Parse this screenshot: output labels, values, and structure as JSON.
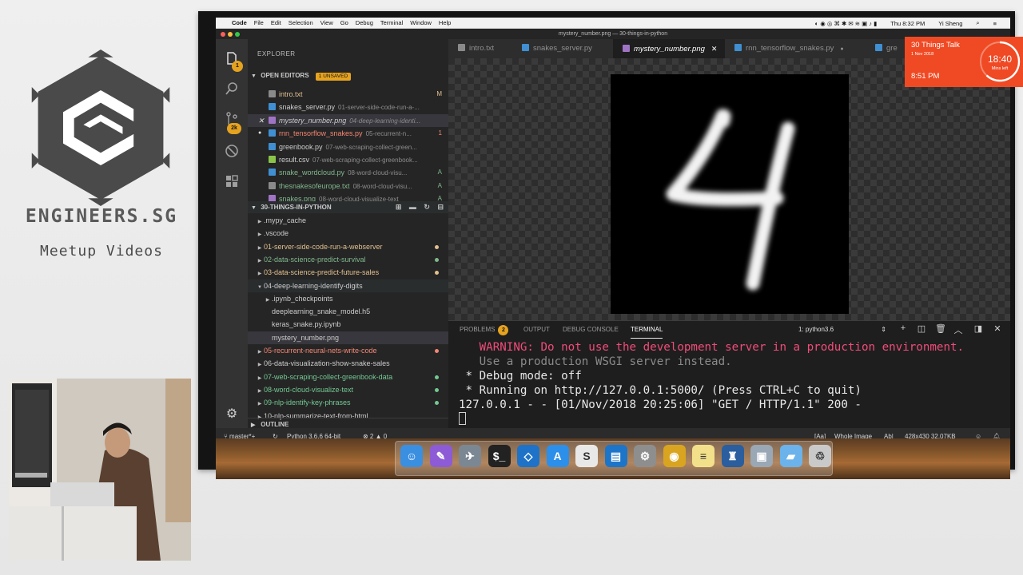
{
  "branding": {
    "name": "ENGINEERS.SG",
    "subtitle": "Meetup Videos"
  },
  "menubar": {
    "apple": "",
    "app": "Code",
    "items": [
      "File",
      "Edit",
      "Selection",
      "View",
      "Go",
      "Debug",
      "Terminal",
      "Window",
      "Help"
    ],
    "clock": "Thu 8:32 PM",
    "user": "Yi Sheng"
  },
  "window": {
    "title": "mystery_number.png — 30-things-in-python"
  },
  "activity": {
    "explorer_badge": "1",
    "scm_badge": "2k"
  },
  "sidebar": {
    "title": "EXPLORER",
    "open_editors": {
      "label": "OPEN EDITORS",
      "badge": "1 UNSAVED",
      "items": [
        {
          "name": "intro.txt",
          "path": "",
          "status": "M",
          "color": "#e2c08d",
          "icon": "text-file-icon"
        },
        {
          "name": "snakes_server.py",
          "path": "01-server-side-code-run-a-...",
          "status": "",
          "color": "#cccccc",
          "icon": "python-file-icon"
        },
        {
          "name": "mystery_number.png",
          "path": "04-deep-learning-identi...",
          "status": "",
          "color": "#cccccc",
          "icon": "image-file-icon"
        },
        {
          "name": "rnn_tensorflow_snakes.py",
          "path": "05-recurrent-n...",
          "status": "1",
          "color": "#f48771",
          "icon": "python-file-icon"
        },
        {
          "name": "greenbook.py",
          "path": "07-web-scraping-collect-green...",
          "status": "",
          "color": "#cccccc",
          "icon": "python-file-icon"
        },
        {
          "name": "result.csv",
          "path": "07-web-scraping-collect-greenbook...",
          "status": "",
          "color": "#cccccc",
          "icon": "csv-file-icon"
        },
        {
          "name": "snake_wordcloud.py",
          "path": "08-word-cloud-visu...",
          "status": "A",
          "color": "#81b88b",
          "icon": "python-file-icon"
        },
        {
          "name": "thesnakesofeurope.txt",
          "path": "08-word-cloud-visu...",
          "status": "A",
          "color": "#81b88b",
          "icon": "text-file-icon"
        },
        {
          "name": "snakes.png",
          "path": "08-word-cloud-visualize-text",
          "status": "A",
          "color": "#81b88b",
          "icon": "image-file-icon"
        }
      ]
    },
    "project": {
      "label": "30-THINGS-IN-PYTHON",
      "items": [
        {
          "name": ".mypy_cache",
          "color": "#cccccc"
        },
        {
          "name": ".vscode",
          "color": "#cccccc"
        },
        {
          "name": "01-server-side-code-run-a-webserver",
          "color": "#e2c08d"
        },
        {
          "name": "02-data-science-predict-survival",
          "color": "#81b88b"
        },
        {
          "name": "03-data-science-predict-future-sales",
          "color": "#e2c08d"
        },
        {
          "name": "04-deep-learning-identify-digits",
          "color": "#cccccc"
        },
        {
          "name": ".ipynb_checkpoints",
          "color": "#cccccc"
        },
        {
          "name": "deeplearning_snake_model.h5",
          "color": "#cccccc"
        },
        {
          "name": "keras_snake.py.ipynb",
          "color": "#cccccc"
        },
        {
          "name": "mystery_number.png",
          "color": "#cccccc"
        },
        {
          "name": "05-recurrent-neural-nets-write-code",
          "color": "#f48771"
        },
        {
          "name": "06-data-visualization-show-snake-sales",
          "color": "#cccccc"
        },
        {
          "name": "07-web-scraping-collect-greenbook-data",
          "color": "#73c991"
        },
        {
          "name": "08-word-cloud-visualize-text",
          "color": "#73c991"
        },
        {
          "name": "09-nlp-identify-key-phrases",
          "color": "#73c991"
        },
        {
          "name": "10-nlp-summarize-text-from-html",
          "color": "#cccccc"
        }
      ]
    },
    "outline_label": "OUTLINE"
  },
  "tabs": [
    {
      "label": "intro.txt",
      "icon": "text-file-icon"
    },
    {
      "label": "snakes_server.py",
      "icon": "python-file-icon"
    },
    {
      "label": "mystery_number.png",
      "icon": "image-file-icon",
      "active": true
    },
    {
      "label": "rnn_tensorflow_snakes.py",
      "icon": "python-file-icon"
    },
    {
      "label": "gre",
      "icon": "python-file-icon"
    }
  ],
  "image_preview": {
    "glyph": "4"
  },
  "panel": {
    "tabs": [
      "PROBLEMS",
      "OUTPUT",
      "DEBUG CONSOLE",
      "TERMINAL"
    ],
    "problems_count": "2",
    "active_tab": "TERMINAL",
    "terminal_select": "1: python3.6",
    "terminal_lines": [
      {
        "text": "   WARNING: Do not use the development server in a production environment.",
        "style": "warn"
      },
      {
        "text": "   Use a production WSGI server instead.",
        "style": "dim"
      },
      {
        "text": " * Debug mode: off",
        "style": ""
      },
      {
        "text": " * Running on http://127.0.0.1:5000/ (Press CTRL+C to quit)",
        "style": ""
      },
      {
        "text": "127.0.0.1 - - [01/Nov/2018 20:25:06] \"GET / HTTP/1.1\" 200 -",
        "style": ""
      }
    ]
  },
  "statusbar": {
    "branch": "master*+",
    "python": "Python 3.6.6 64-bit",
    "problems": "⊗ 2 ▲ 0",
    "search_case": "[Aa]",
    "whole_image": "Whole Image",
    "ab": "Ab|",
    "image_info": "428x430 32.07KB"
  },
  "talk_timer": {
    "title": "30 Things Talk",
    "date": "1 Nov 2018",
    "time": "8:51 PM",
    "countdown": "18:40",
    "caption": "Mins left",
    "remaining_fraction": 0.62
  },
  "dock": [
    {
      "name": "finder-icon",
      "glyph": "☺",
      "color": "#3a8fe0"
    },
    {
      "name": "quill-icon",
      "glyph": "✎",
      "color": "#8e5bd6"
    },
    {
      "name": "launchpad-icon",
      "glyph": "✈",
      "color": "#7c8794"
    },
    {
      "name": "terminal-app-icon",
      "glyph": "$_",
      "color": "#222222"
    },
    {
      "name": "vscode-icon",
      "glyph": "◇",
      "color": "#1e73c8"
    },
    {
      "name": "appstore-icon",
      "glyph": "A",
      "color": "#2c8fea"
    },
    {
      "name": "slides-icon",
      "glyph": "S",
      "color": "#e8e8e8"
    },
    {
      "name": "trello-icon",
      "glyph": "▤",
      "color": "#1d75c9"
    },
    {
      "name": "preferences-icon",
      "glyph": "⚙",
      "color": "#8e8e8e"
    },
    {
      "name": "chrome-icon",
      "glyph": "◉",
      "color": "#d9a521"
    },
    {
      "name": "notes-icon",
      "glyph": "≡",
      "color": "#f2e08b"
    },
    {
      "name": "elephant-icon",
      "glyph": "♜",
      "color": "#2a5e9e"
    },
    {
      "name": "preview-icon",
      "glyph": "▣",
      "color": "#9aa7b5"
    },
    {
      "name": "folder-icon",
      "glyph": "▰",
      "color": "#6bb3ea"
    },
    {
      "name": "trash-icon",
      "glyph": "♲",
      "color": "#c9c9c9"
    }
  ]
}
